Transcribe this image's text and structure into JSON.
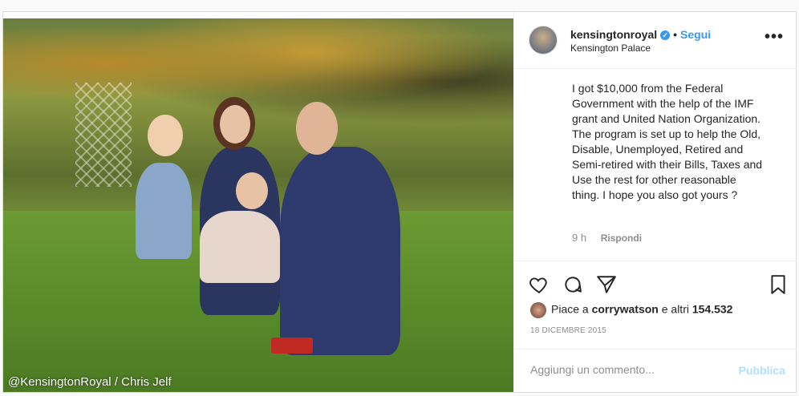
{
  "post": {
    "username": "kensingtonroyal",
    "follow_label": "Segui",
    "separator": "•",
    "location": "Kensington Palace",
    "more_label": "•••",
    "caption": "I got $10,000 from the Federal Government with the help of the IMF grant and United Nation Organization. The program is set up to help the Old, Disable, Unemployed, Retired and Semi-retired with their Bills, Taxes and Use the rest for other reasonable thing. I hope you also got yours ?",
    "caption_age": "9 h",
    "reply_label": "Rispondi",
    "likes_prefix": "Piace a",
    "likes_user": "corrywatson",
    "likes_suffix": "e altri",
    "likes_count": "154.532",
    "date": "18 DICEMBRE 2015",
    "comment_placeholder": "Aggiungi un commento...",
    "publish_label": "Pubblica",
    "photo_credit": "@KensingtonRoyal / Chris Jelf"
  },
  "icons": {
    "verified": "verified-badge-icon",
    "like": "heart-icon",
    "comment": "comment-icon",
    "share": "share-icon",
    "save": "bookmark-icon"
  },
  "colors": {
    "accent": "#3897f0",
    "publish_disabled": "#b2dffc"
  }
}
